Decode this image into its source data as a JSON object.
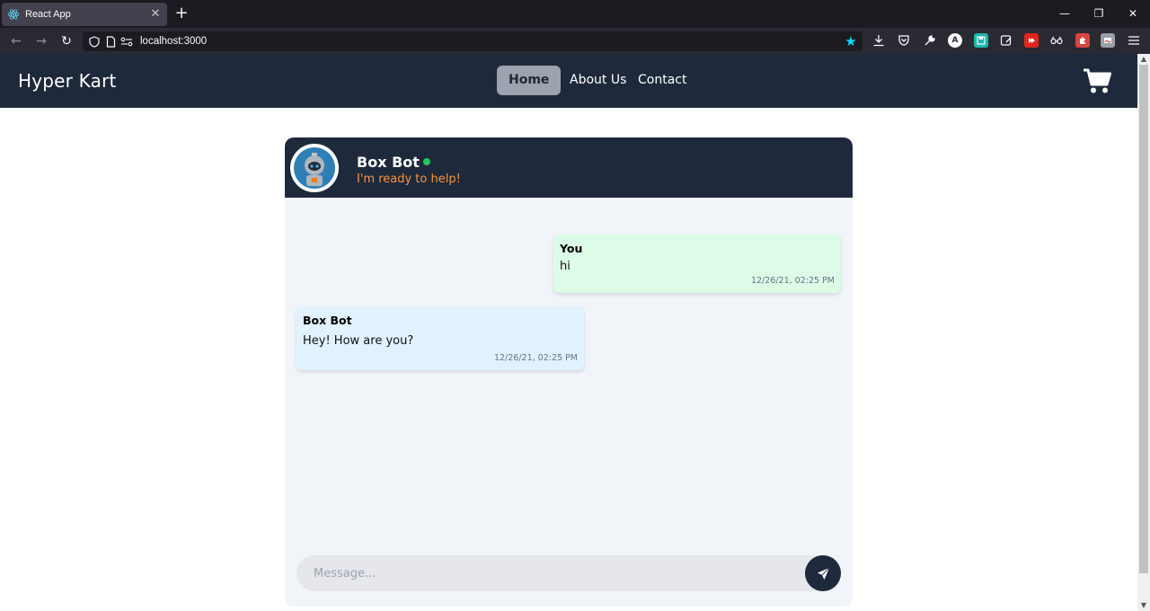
{
  "browser": {
    "tab_title": "React App",
    "tab_close": "✕",
    "new_tab": "+",
    "url": "localhost:3000",
    "back": "←",
    "forward": "→",
    "reload": "↻",
    "win_minimize": "—",
    "win_restore": "❐",
    "win_close": "✕"
  },
  "header": {
    "brand": "Hyper Kart",
    "nav": [
      {
        "label": "Home",
        "active": true
      },
      {
        "label": "About Us",
        "active": false
      },
      {
        "label": "Contact",
        "active": false
      }
    ],
    "cart_icon": "cart-icon"
  },
  "chat": {
    "bot_name": "Box Bot",
    "status": "I'm ready to help!",
    "messages": [
      {
        "sender": "You",
        "text": "hi",
        "time": "12/26/21, 02:25 PM"
      },
      {
        "sender": "Box Bot",
        "text": "Hey! How are you?",
        "time": "12/26/21, 02:25 PM"
      }
    ],
    "input_placeholder": "Message...",
    "input_value": ""
  },
  "colors": {
    "header_bg": "#1e293b",
    "user_bubble": "#dcfce7",
    "bot_bubble": "#e0f2fe",
    "status_orange": "#fb923c",
    "online_green": "#22c55e"
  }
}
